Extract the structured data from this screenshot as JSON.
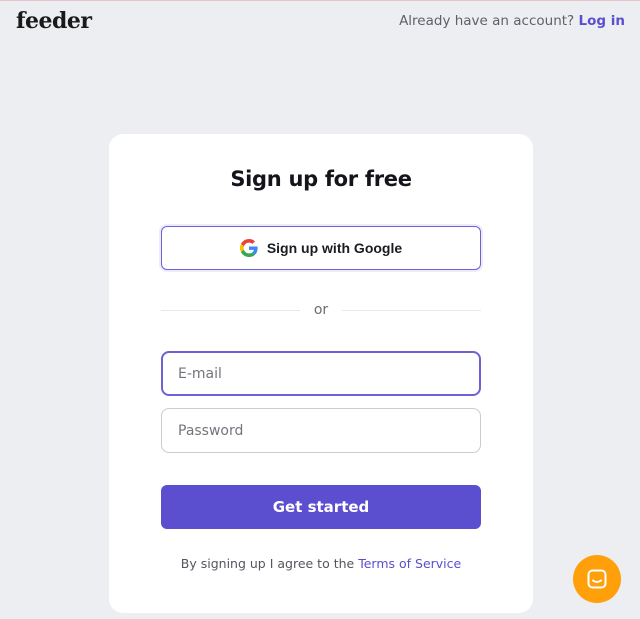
{
  "header": {
    "logo": "feeder",
    "account_prompt": "Already have an account?",
    "login_link": "Log in"
  },
  "signup": {
    "title": "Sign up for free",
    "google_button": "Sign up with Google",
    "divider_text": "or",
    "email_placeholder": "E-mail",
    "password_placeholder": "Password",
    "submit_button": "Get started",
    "terms_prefix": "By signing up I agree to the",
    "terms_link": "Terms of Service"
  },
  "colors": {
    "accent": "#5c4fcf",
    "chat_button": "#ff9f0a",
    "background": "#edeef1"
  },
  "icons": {
    "google": "google-g-icon",
    "chat": "chat-bubble-icon"
  }
}
